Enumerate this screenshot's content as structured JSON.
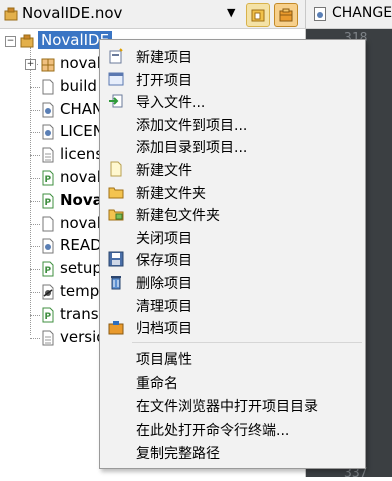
{
  "toolbar": {
    "project_name": "NovalIDE.nov",
    "dropdown_icon": "chevron-down-icon",
    "buttons": [
      "open-project-icon",
      "package-project-icon"
    ]
  },
  "editor": {
    "tab_label": "CHANGE",
    "line_top": "318",
    "line_bottom": "337"
  },
  "tree": {
    "root": "NovalIDE",
    "items": [
      {
        "label": "noval",
        "icon": "package-icon",
        "bold": false
      },
      {
        "label": "build",
        "icon": "file-icon",
        "bold": false
      },
      {
        "label": "CHAN",
        "icon": "settings-file-icon",
        "bold": false
      },
      {
        "label": "LICEN",
        "icon": "settings-file-icon",
        "bold": false
      },
      {
        "label": "licens",
        "icon": "text-file-icon",
        "bold": false
      },
      {
        "label": "noval",
        "icon": "python-file-icon",
        "bold": false
      },
      {
        "label": "Nova",
        "icon": "python-file-icon",
        "bold": true
      },
      {
        "label": "noval",
        "icon": "file-icon",
        "bold": false
      },
      {
        "label": "READ",
        "icon": "settings-file-icon",
        "bold": false
      },
      {
        "label": "setup",
        "icon": "python-file-icon",
        "bold": false
      },
      {
        "label": "temp",
        "icon": "executable-icon",
        "bold": false
      },
      {
        "label": "transl",
        "icon": "python-file-icon",
        "bold": false
      },
      {
        "label": "versio",
        "icon": "text-file-icon",
        "bold": false
      }
    ]
  },
  "context_menu": {
    "group1": [
      {
        "label": "新建项目",
        "icon": "new-project-icon"
      },
      {
        "label": "打开项目",
        "icon": "open-project-icon"
      },
      {
        "label": "导入文件...",
        "icon": "import-icon"
      },
      {
        "label": "添加文件到项目...",
        "icon": ""
      },
      {
        "label": "添加目录到项目...",
        "icon": ""
      },
      {
        "label": "新建文件",
        "icon": "new-file-icon"
      },
      {
        "label": "新建文件夹",
        "icon": "new-folder-icon"
      },
      {
        "label": "新建包文件夹",
        "icon": "new-package-folder-icon"
      },
      {
        "label": "关闭项目",
        "icon": ""
      },
      {
        "label": "保存项目",
        "icon": "save-icon"
      },
      {
        "label": "删除项目",
        "icon": "delete-icon"
      },
      {
        "label": "清理项目",
        "icon": ""
      },
      {
        "label": "归档项目",
        "icon": "archive-icon"
      }
    ],
    "group2": [
      {
        "label": "项目属性"
      },
      {
        "label": "重命名"
      },
      {
        "label": "在文件浏览器中打开项目目录"
      },
      {
        "label": "在此处打开命令行终端..."
      },
      {
        "label": "复制完整路径"
      }
    ]
  },
  "colors": {
    "selection": "#3a75c4",
    "menu_bg": "#f2f2f2",
    "editor_bg": "#3b3f42",
    "python_file": "#3f8f3f"
  }
}
